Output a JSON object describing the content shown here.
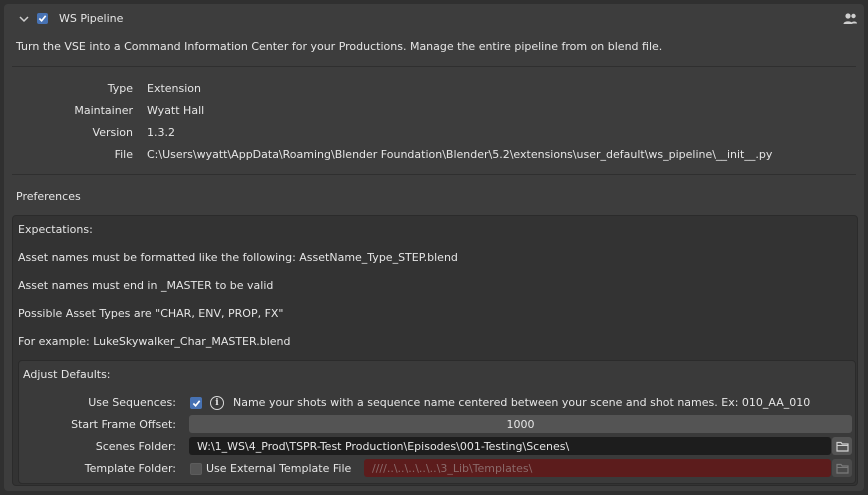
{
  "header": {
    "title": "WS Pipeline",
    "enabled": true,
    "user_icon": "user-settings-icon"
  },
  "description": "Turn the VSE into a Command Information Center for your Productions. Manage the entire pipeline from on blend file.",
  "info": {
    "type_label": "Type",
    "type_value": "Extension",
    "maintainer_label": "Maintainer",
    "maintainer_value": "Wyatt Hall",
    "version_label": "Version",
    "version_value": "1.3.2",
    "file_label": "File",
    "file_value": "C:\\Users\\wyatt\\AppData\\Roaming\\Blender Foundation\\Blender\\5.2\\extensions\\user_default\\ws_pipeline\\__init__.py"
  },
  "preferences": {
    "title": "Preferences",
    "lines": [
      "Expectations:",
      "Asset names must be formatted like the following: AssetName_Type_STEP.blend",
      "Asset names must end in _MASTER to be valid",
      "Possible Asset Types are \"CHAR, ENV, PROP, FX\"",
      "For example: LukeSkywalker_Char_MASTER.blend"
    ],
    "defaults": {
      "title": "Adjust Defaults:",
      "use_sequences_label": "Use Sequences:",
      "use_sequences_checked": true,
      "use_sequences_hint": "Name your shots with a sequence name centered between your scene and shot names. Ex: 010_AA_010",
      "start_frame_label": "Start Frame Offset:",
      "start_frame_value": "1000",
      "scenes_folder_label": "Scenes Folder:",
      "scenes_folder_value": "W:\\1_WS\\4_Prod\\TSPR-Test Production\\Episodes\\001-Testing\\Scenes\\",
      "template_folder_label": "Template Folder:",
      "use_external_template_label": "Use External Template File",
      "use_external_template_checked": false,
      "template_folder_value": "////..\\..\\..\\..\\..\\3_Lib\\Templates\\"
    }
  },
  "colors": {
    "accent": "#4772b3",
    "panel": "#3d3d3d",
    "field": "#1d1d1d",
    "invalid_field": "#5c1c1c"
  }
}
